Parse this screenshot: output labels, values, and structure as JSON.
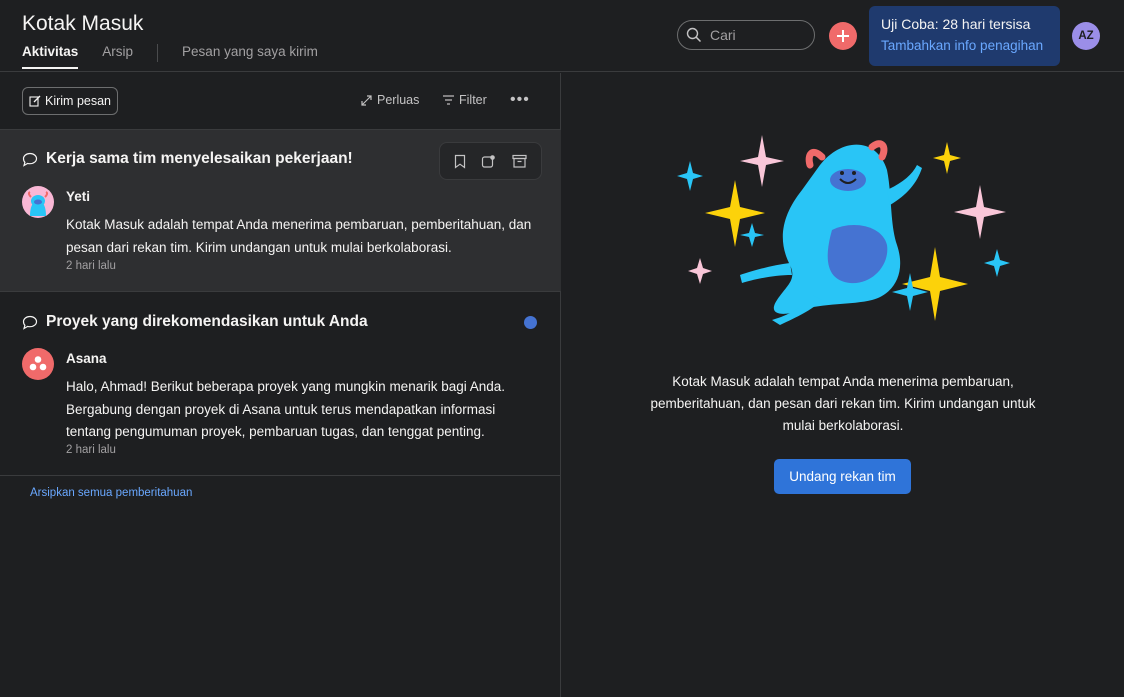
{
  "header": {
    "title": "Kotak Masuk",
    "tabs": [
      {
        "label": "Aktivitas",
        "active": true
      },
      {
        "label": "Arsip",
        "active": false
      },
      {
        "label": "Pesan yang saya kirim",
        "active": false
      }
    ],
    "search": {
      "placeholder": "Cari",
      "icon": "search-icon"
    },
    "add_icon": "plus-icon",
    "trial": {
      "status": "Uji Coba: 28 hari tersisa",
      "link": "Tambahkan info penagihan"
    },
    "avatar_initials": "AZ"
  },
  "toolbar": {
    "compose_label": "Kirim pesan",
    "expand_label": "Perluas",
    "filter_label": "Filter",
    "more_icon": "more-horizontal-icon"
  },
  "notifications": [
    {
      "title": "Kerja sama tim menyelesaikan pekerjaan!",
      "sender": "Yeti",
      "body": "Kotak Masuk adalah tempat Anda menerima pembaruan, pemberitahuan, dan pesan dari rekan tim. Kirim undangan untuk mulai berkolaborasi.",
      "time": "2 hari lalu",
      "unread": false,
      "actions": [
        "bookmark-icon",
        "reminder-icon",
        "archive-icon"
      ]
    },
    {
      "title": "Proyek yang direkomendasikan untuk Anda",
      "sender": "Asana",
      "body": "Halo, Ahmad! Berikut beberapa proyek yang mungkin menarik bagi Anda. Bergabung dengan proyek di Asana untuk terus mendapatkan informasi tentang pengumuman proyek, pembaruan tugas, dan tenggat penting.",
      "time": "2 hari lalu",
      "unread": true
    }
  ],
  "archive_all_label": "Arsipkan semua pemberitahuan",
  "right_panel": {
    "text": "Kotak Masuk adalah tempat Anda menerima pembaruan, pemberitahuan, dan pesan dari rekan tim. Kirim undangan untuk mulai berkolaborasi.",
    "invite_label": "Undang rekan tim"
  },
  "colors": {
    "background": "#1e1f21",
    "accent_red": "#f06a6a",
    "primary_blue": "#2f74d9",
    "link_blue": "#6aa8ff",
    "trial_bg": "#1f3a6e",
    "unread_dot": "#4573d2"
  }
}
